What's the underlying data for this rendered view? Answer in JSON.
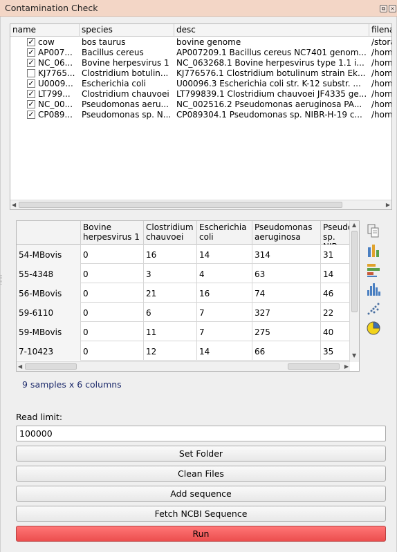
{
  "window": {
    "title": "Contamination Check"
  },
  "tree": {
    "columns": [
      "name",
      "species",
      "desc",
      "filena"
    ],
    "rows": [
      {
        "checked": true,
        "name": "cow",
        "species": "bos taurus",
        "desc": "bovine genome",
        "file": "/stora"
      },
      {
        "checked": true,
        "name": "AP007...",
        "species": "Bacillus cereus",
        "desc": "AP007209.1 Bacillus cereus NC7401 genom...",
        "file": "/hom"
      },
      {
        "checked": true,
        "name": "NC_06...",
        "species": "Bovine herpesvirus 1",
        "desc": "NC_063268.1 Bovine herpesvirus type 1.1 i...",
        "file": "/hom"
      },
      {
        "checked": false,
        "name": "KJ7765...",
        "species": "Clostridium botulin...",
        "desc": "KJ776576.1 Clostridium botulinum strain Ek...",
        "file": "/hom"
      },
      {
        "checked": true,
        "name": "U0009...",
        "species": "Escherichia coli",
        "desc": "U00096.3 Escherichia coli str. K-12 substr. ...",
        "file": "/hom"
      },
      {
        "checked": true,
        "name": "LT799...",
        "species": "Clostridium chauvoei",
        "desc": "LT799839.1 Clostridium chauvoei JF4335 ge...",
        "file": "/hom"
      },
      {
        "checked": true,
        "name": "NC_00...",
        "species": "Pseudomonas aeru...",
        "desc": "NC_002516.2 Pseudomonas aeruginosa PA...",
        "file": "/hom"
      },
      {
        "checked": true,
        "name": "CP089...",
        "species": "Pseudomonas sp. N...",
        "desc": "CP089304.1 Pseudomonas sp. NIBR-H-19 c...",
        "file": "/hom"
      }
    ]
  },
  "grid": {
    "columns": [
      "",
      "Bovine herpesvirus 1",
      "Clostridium chauvoei",
      "Escherichia coli",
      "Pseudomonas aeruginosa",
      "Pseudo sp. NIB"
    ],
    "rows": [
      {
        "name": "54-MBovis",
        "values": [
          "0",
          "16",
          "14",
          "314",
          "31"
        ]
      },
      {
        "name": "55-4348",
        "values": [
          "0",
          "3",
          "4",
          "63",
          "14"
        ]
      },
      {
        "name": "56-MBovis",
        "values": [
          "0",
          "21",
          "16",
          "74",
          "46"
        ]
      },
      {
        "name": "59-6110",
        "values": [
          "0",
          "6",
          "7",
          "327",
          "22"
        ]
      },
      {
        "name": "59-MBovis",
        "values": [
          "0",
          "11",
          "7",
          "275",
          "40"
        ]
      },
      {
        "name": "7-10423",
        "values": [
          "0",
          "12",
          "14",
          "66",
          "35"
        ]
      }
    ]
  },
  "side_icons": [
    "copy-icon",
    "bar-chart-icon",
    "horizontal-bar-chart-icon",
    "histogram-icon",
    "scatter-plot-icon",
    "pie-chart-icon"
  ],
  "summary": "9 samples x 6 columns",
  "read_limit": {
    "label": "Read limit:",
    "value": "100000"
  },
  "buttons": {
    "set_folder": "Set Folder",
    "clean_files": "Clean Files",
    "add_sequence": "Add sequence",
    "fetch_ncbi": "Fetch NCBI Sequence",
    "run": "Run"
  }
}
